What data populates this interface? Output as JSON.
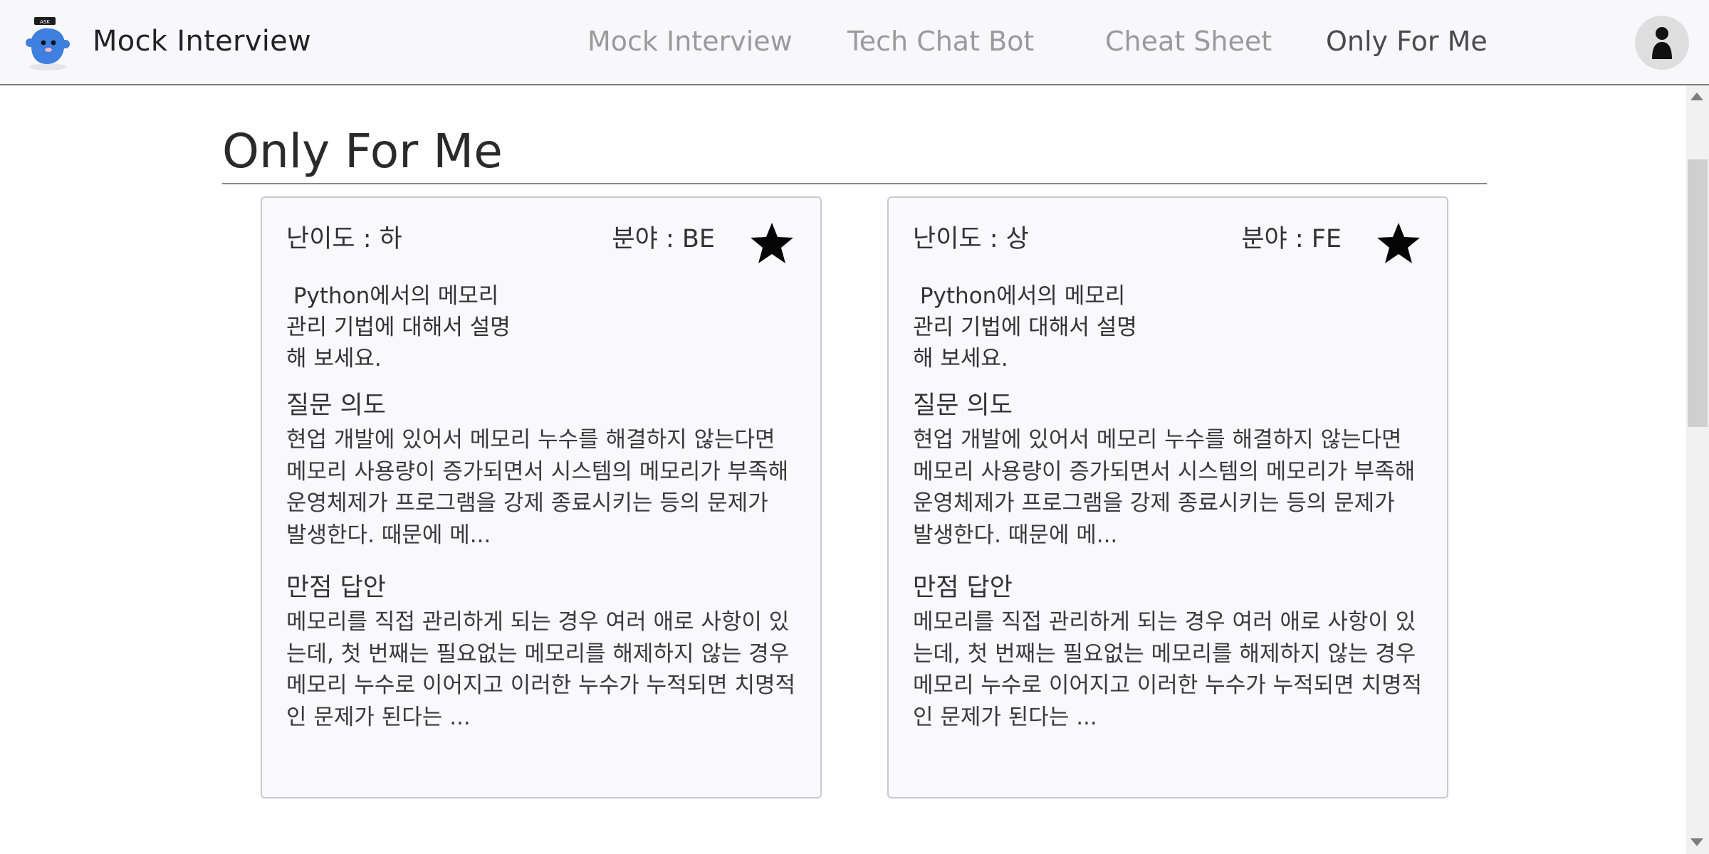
{
  "header": {
    "app_title": "Mock Interview",
    "logo_flag_text": "ASK",
    "nav": [
      {
        "label": "Mock Interview",
        "active": false
      },
      {
        "label": "Tech Chat Bot",
        "active": false
      },
      {
        "label": "Cheat Sheet",
        "active": false
      },
      {
        "label": "Only For Me",
        "active": true
      }
    ]
  },
  "page": {
    "title": "Only For Me"
  },
  "cards": [
    {
      "difficulty": "난이도 : 하",
      "field": "분야 : BE",
      "starred": true,
      "question_lines": [
        " Python에서의 메모리",
        "관리 기법에 대해서 설명",
        "해 보세요."
      ],
      "intent_title": "질문 의도",
      "intent_lines": [
        "현업 개발에 있어서 메모리 누수를 해결하지 않는다면",
        "메모리 사용량이 증가되면서 시스템의 메모리가 부족해",
        "운영체제가 프로그램을 강제 종료시키는 등의 문제가",
        "발생한다. 때문에 메..."
      ],
      "answer_title": "만점 답안",
      "answer_lines": [
        "메모리를 직접 관리하게 되는 경우 여러 애로 사항이 있",
        "는데, 첫 번째는 필요없는 메모리를 해제하지 않는 경우",
        "메모리 누수로 이어지고 이러한 누수가 누적되면 치명적",
        "인 문제가 된다는 ..."
      ]
    },
    {
      "difficulty": "난이도 : 상",
      "field": "분야 : FE",
      "starred": true,
      "question_lines": [
        " Python에서의 메모리",
        "관리 기법에 대해서 설명",
        "해 보세요."
      ],
      "intent_title": "질문 의도",
      "intent_lines": [
        "현업 개발에 있어서 메모리 누수를 해결하지 않는다면",
        "메모리 사용량이 증가되면서 시스템의 메모리가 부족해",
        "운영체제가 프로그램을 강제 종료시키는 등의 문제가",
        "발생한다. 때문에 메..."
      ],
      "answer_title": "만점 답안",
      "answer_lines": [
        "메모리를 직접 관리하게 되는 경우 여러 애로 사항이 있",
        "는데, 첫 번째는 필요없는 메모리를 해제하지 않는 경우",
        "메모리 누수로 이어지고 이러한 누수가 누적되면 치명적",
        "인 문제가 된다는 ..."
      ]
    }
  ],
  "icons": {
    "star": "star-icon",
    "avatar": "user-icon",
    "logo": "mascot-logo"
  },
  "colors": {
    "header_bg": "#f8f8fa",
    "nav_inactive": "#9a9a9a",
    "nav_active": "#4a4a4a",
    "card_bg": "#f9f9fc",
    "logo_blue": "#3f7fe0"
  }
}
